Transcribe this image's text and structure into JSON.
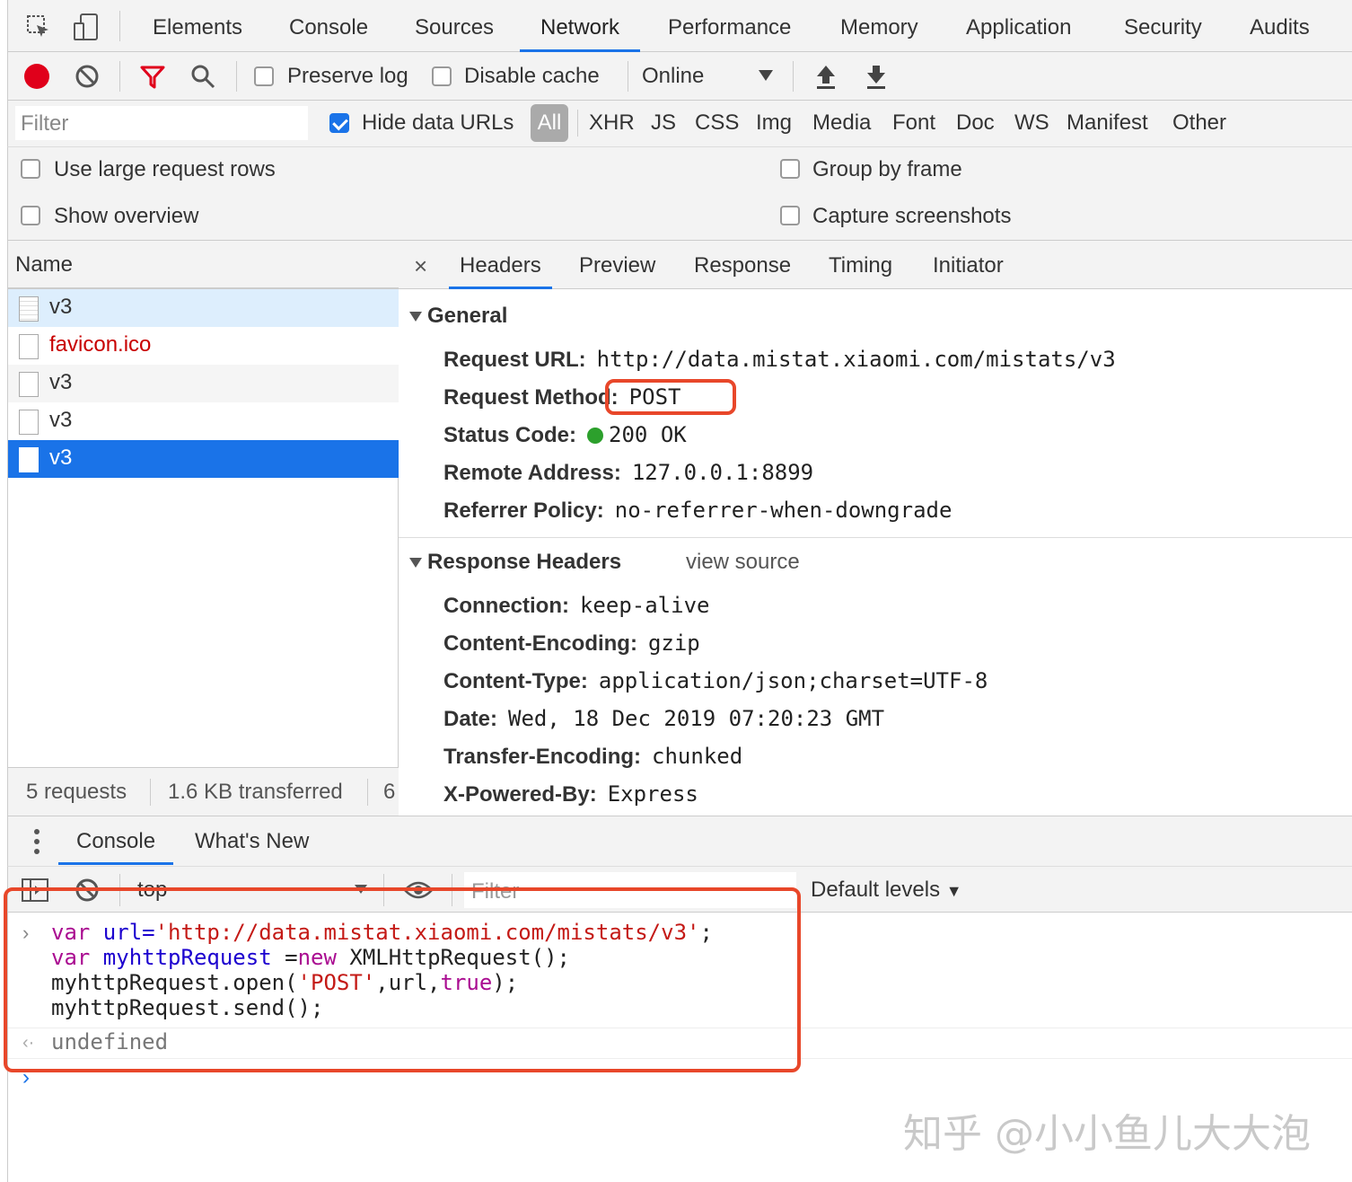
{
  "tabs": [
    "Elements",
    "Console",
    "Sources",
    "Network",
    "Performance",
    "Memory",
    "Application",
    "Security",
    "Audits"
  ],
  "active_tab": "Network",
  "toolbar": {
    "preserve_log": "Preserve log",
    "disable_cache": "Disable cache",
    "throttle": "Online"
  },
  "filterbar": {
    "placeholder": "Filter",
    "hide_data_urls": "Hide data URLs",
    "types": [
      "All",
      "XHR",
      "JS",
      "CSS",
      "Img",
      "Media",
      "Font",
      "Doc",
      "WS",
      "Manifest",
      "Other"
    ]
  },
  "options": {
    "large_rows": "Use large request rows",
    "show_overview": "Show overview",
    "group_by_frame": "Group by frame",
    "capture_screenshots": "Capture screenshots"
  },
  "name_panel": {
    "header": "Name",
    "requests": [
      "v3",
      "favicon.ico",
      "v3",
      "v3",
      "v3"
    ],
    "summary_requests": "5 requests",
    "summary_transferred": "1.6 KB transferred",
    "summary_more": "6"
  },
  "detail_tabs": {
    "close": "×",
    "items": [
      "Headers",
      "Preview",
      "Response",
      "Timing",
      "Initiator"
    ]
  },
  "general": {
    "title": "General",
    "request_url_k": "Request URL:",
    "request_url_v": "http://data.mistat.xiaomi.com/mistats/v3",
    "method_k": "Request Method:",
    "method_v": "POST",
    "status_k": "Status Code:",
    "status_v": "200 OK",
    "remote_k": "Remote Address:",
    "remote_v": "127.0.0.1:8899",
    "referrer_k": "Referrer Policy:",
    "referrer_v": "no-referrer-when-downgrade"
  },
  "response_headers": {
    "title": "Response Headers",
    "view_source": "view source",
    "connection_k": "Connection:",
    "connection_v": "keep-alive",
    "encoding_k": "Content-Encoding:",
    "encoding_v": "gzip",
    "type_k": "Content-Type:",
    "type_v": "application/json;charset=UTF-8",
    "date_k": "Date:",
    "date_v": "Wed, 18 Dec 2019 07:20:23 GMT",
    "transfer_k": "Transfer-Encoding:",
    "transfer_v": "chunked",
    "powered_k": "X-Powered-By:",
    "powered_v": "Express"
  },
  "drawer": {
    "tabs": [
      "Console",
      "What's New"
    ],
    "context": "top",
    "filter_placeholder": "Filter",
    "levels": "Default levels"
  },
  "console": {
    "line1_kw": "var",
    "line1_var": " url=",
    "line1_str": "'http://data.mistat.xiaomi.com/mistats/v3'",
    "line1_end": ";",
    "line2_kw": "var",
    "line2_var": " myhttpRequest ",
    "line2_eq": "=",
    "line2_new": "new",
    "line2_end": " XMLHttpRequest();",
    "line3_a": "myhttpRequest.open(",
    "line3_str": "'POST'",
    "line3_b": ",url,",
    "line3_kw": "true",
    "line3_c": ");",
    "line4": "myhttpRequest.send();",
    "result": "undefined"
  },
  "watermark": "知乎 @小小鱼儿大大泡",
  "colors": {
    "accent": "#1a73e8",
    "highlight": "#e8472a",
    "error_text": "#c80000"
  }
}
